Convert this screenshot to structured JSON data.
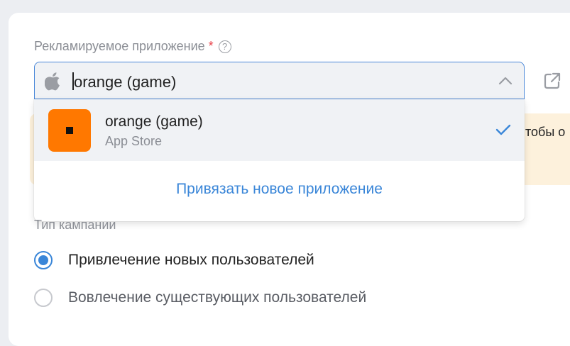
{
  "field": {
    "label": "Рекламируемое приложение",
    "required_mark": "*",
    "help_glyph": "?",
    "selected_value": "orange (game)",
    "platform_icon": "apple-icon",
    "open_icon": "external-link-icon"
  },
  "dropdown": {
    "options": [
      {
        "name": "orange (game)",
        "store": "App Store",
        "selected": true,
        "icon_color": "#ff7800"
      }
    ],
    "link_new_app": "Привязать новое приложение"
  },
  "warning": {
    "text_fragment": "тобы о"
  },
  "campaign": {
    "label": "Тип кампании",
    "options": [
      {
        "label": "Привлечение новых пользователей",
        "checked": true
      },
      {
        "label": "Вовлечение существующих пользователей",
        "checked": false
      }
    ]
  },
  "colors": {
    "accent": "#3a86d8",
    "app_icon": "#ff7800",
    "warning_bg": "#fdf1dc",
    "required": "#e8424a"
  }
}
